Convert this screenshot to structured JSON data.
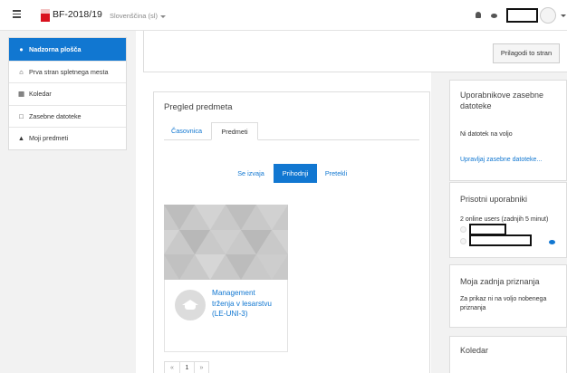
{
  "navbar": {
    "site_name": "BF-2018/19",
    "language": "Slovenščina (sl)"
  },
  "nav": {
    "items": [
      {
        "label": "Nadzorna plošča",
        "icon": "dashboard-icon",
        "active": true
      },
      {
        "label": "Prva stran spletnega mesta",
        "icon": "home-icon",
        "active": false
      },
      {
        "label": "Koledar",
        "icon": "calendar-icon",
        "active": false
      },
      {
        "label": "Zasebne datoteke",
        "icon": "file-icon",
        "active": false
      },
      {
        "label": "Moji predmeti",
        "icon": "graduation-cap-icon",
        "active": false
      }
    ]
  },
  "main": {
    "customise_label": "Prilagodi to stran",
    "overview": {
      "title": "Pregled predmeta",
      "tabs": [
        "Časovnica",
        "Predmeti"
      ],
      "filters": [
        "Se izvaja",
        "Prihodnji",
        "Pretekli"
      ],
      "selected_filter": "Prihodnji",
      "course": {
        "name": "Management trženja v lesarstvu (LE-UNI-3)"
      },
      "pager": {
        "prev": "«",
        "page": "1",
        "next": "»"
      }
    }
  },
  "blocks": {
    "private_files": {
      "title": "Uporabnikove zasebne datoteke",
      "empty_text": "Ni datotek na voljo",
      "manage_link": "Upravljaj zasebne datoteke..."
    },
    "online_users": {
      "title": "Prisotni uporabniki",
      "summary": "2 online users (zadnjih 5 minut)"
    },
    "badges": {
      "title": "Moja zadnja priznanja",
      "empty_text": "Za prikaz ni na voljo nobenega priznanja"
    },
    "calendar": {
      "title": "Koledar"
    }
  },
  "colors": {
    "accent": "#1177d1",
    "brand_red": "#d9121e"
  }
}
